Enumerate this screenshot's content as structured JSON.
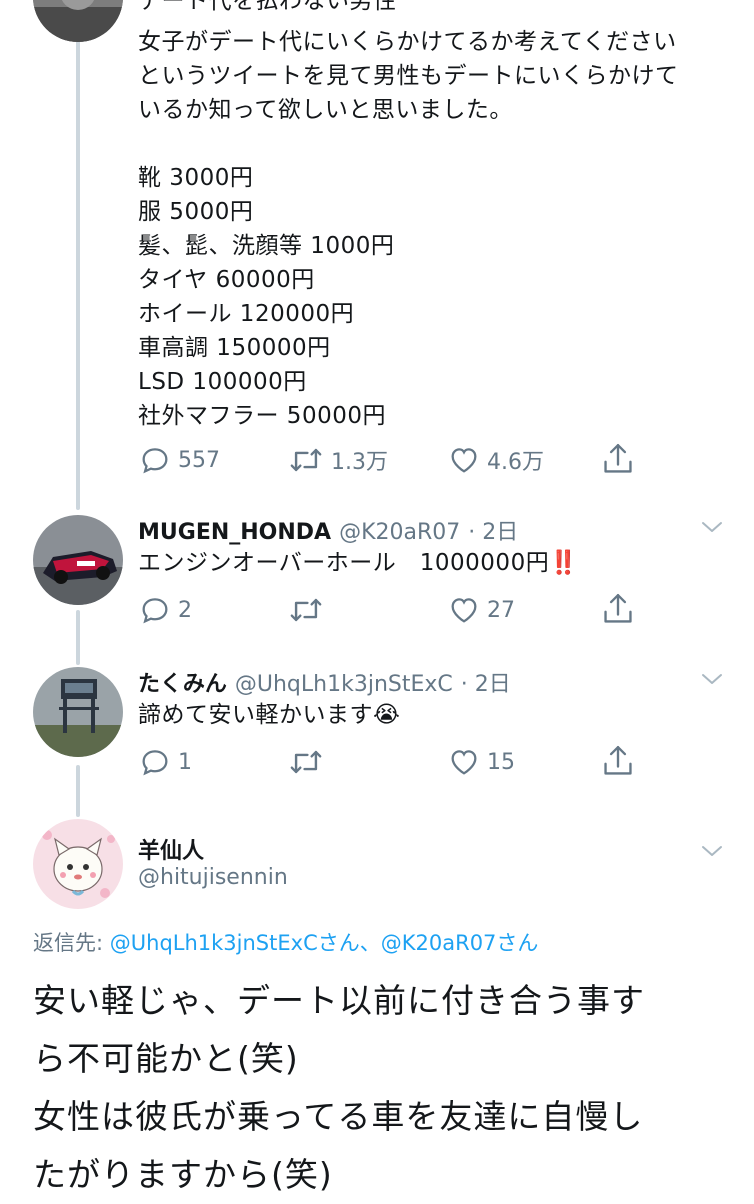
{
  "colors": {
    "accent": "#1da1f2",
    "muted": "#657786",
    "thread": "#ccd6dd"
  },
  "tweet1": {
    "cut_line": "デート代を払わない男性",
    "body": "女子がデート代にいくらかけてるか考えてください\nというツイートを見て男性もデートにいくらかけて\nいるか知って欲しいと思いました。\n\n靴 3000円\n服 5000円\n髪、髭、洗顔等 1000円\nタイヤ 60000円\nホイール 120000円\n車高調 150000円\nLSD 100000円\n社外マフラー 50000円",
    "replies": "557",
    "retweets": "1.3万",
    "likes": "4.6万"
  },
  "tweet2": {
    "name": "MUGEN_HONDA",
    "handle": "@K20aR07",
    "time": "· 2日",
    "body": "エンジンオーバーホール　1000000円",
    "emoji": "‼️",
    "replies": "2",
    "retweets": "",
    "likes": "27"
  },
  "tweet3": {
    "name": "たくみん",
    "handle": "@UhqLh1k3jnStExC",
    "time": "· 2日",
    "body": "諦めて安い軽かいます",
    "emoji": "😭",
    "replies": "1",
    "retweets": "",
    "likes": "15"
  },
  "focused": {
    "name": "羊仙人",
    "handle": "@hitujisennin",
    "reply_prefix": "返信先: ",
    "reply_to": "@UhqLh1k3jnStExCさん、@K20aR07さん",
    "body": "安い軽じゃ、デート以前に付き合う事す\nら不可能かと(笑)\n女性は彼氏が乗ってる車を友達に自慢し\nたがりますから(笑)"
  }
}
